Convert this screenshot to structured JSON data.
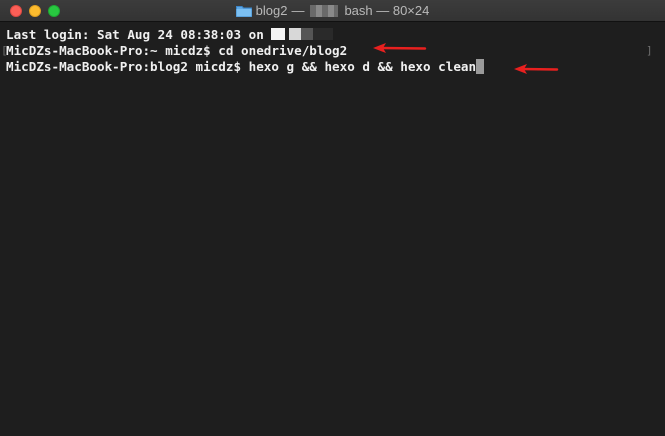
{
  "window": {
    "title_folder": "blog2",
    "title_rest": "bash — 80×24",
    "title_separator": "—"
  },
  "terminal": {
    "line1_prefix": "Last login: Sat Aug 24 08:38:03 on ",
    "line2": "MicDZs-MacBook-Pro:~ micdz$ cd onedrive/blog2",
    "line3": "MicDZs-MacBook-Pro:blog2 micdz$ hexo g && hexo d && hexo clean",
    "bracket_left": "[",
    "bracket_right": "]"
  },
  "colors": {
    "background": "#1e1e1e",
    "text": "#f0f0f0",
    "arrow": "#e8201f",
    "close": "#fc5f57",
    "minimize": "#fdbc2e",
    "maximize": "#28c840"
  },
  "icons": {
    "title_icon": "folder-icon",
    "annotation": "red-arrow-icon"
  }
}
